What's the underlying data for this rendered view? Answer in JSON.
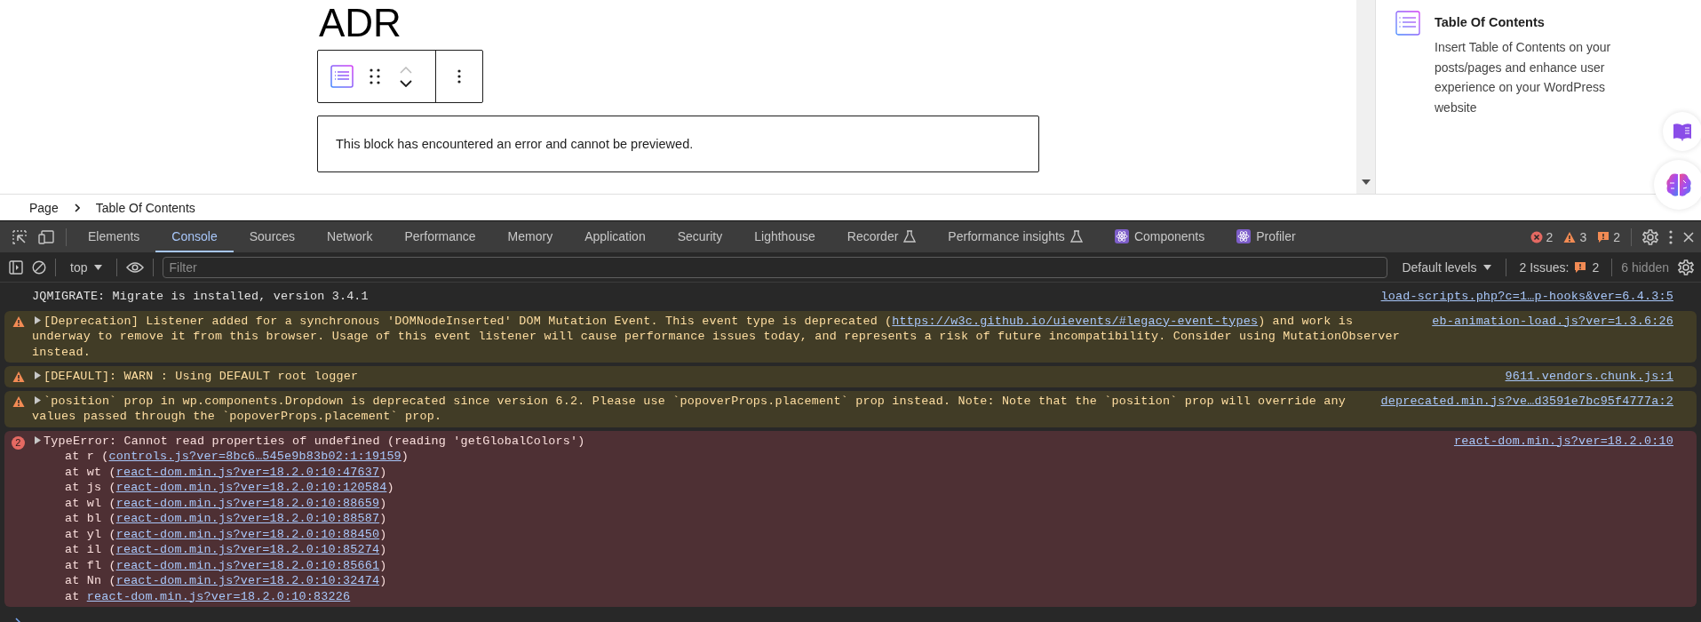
{
  "editor": {
    "heading": "ADR",
    "error_notice": "This block has encountered an error and cannot be previewed."
  },
  "sidebar": {
    "block_title": "Table Of Contents",
    "block_description": "Insert Table of Contents on your posts/pages and enhance user experience on your WordPress website"
  },
  "breadcrumb": [
    "Page",
    "Table Of Contents"
  ],
  "devtools": {
    "tabs": [
      {
        "label": "Elements",
        "selected": false,
        "kind": "plain"
      },
      {
        "label": "Console",
        "selected": true,
        "kind": "plain"
      },
      {
        "label": "Sources",
        "selected": false,
        "kind": "plain"
      },
      {
        "label": "Network",
        "selected": false,
        "kind": "plain"
      },
      {
        "label": "Performance",
        "selected": false,
        "kind": "plain"
      },
      {
        "label": "Memory",
        "selected": false,
        "kind": "plain"
      },
      {
        "label": "Application",
        "selected": false,
        "kind": "plain"
      },
      {
        "label": "Security",
        "selected": false,
        "kind": "plain"
      },
      {
        "label": "Lighthouse",
        "selected": false,
        "kind": "plain"
      },
      {
        "label": "Recorder",
        "selected": false,
        "kind": "experimental"
      },
      {
        "label": "Performance insights",
        "selected": false,
        "kind": "experimental"
      },
      {
        "label": "Components",
        "selected": false,
        "kind": "extension"
      },
      {
        "label": "Profiler",
        "selected": false,
        "kind": "extension"
      }
    ],
    "counts": {
      "errors": "2",
      "warnings": "3",
      "issues": "2"
    },
    "console_toolbar": {
      "context": "top",
      "filter_placeholder": "Filter",
      "levels": "Default levels",
      "issues_label": "2 Issues:",
      "issues_count": "2",
      "hidden": "6 hidden"
    },
    "messages": [
      {
        "kind": "info",
        "parts": [
          {
            "text": "JQMIGRATE: Migrate is installed, version 3.4.1"
          }
        ],
        "source": "load-scripts.php?c=1…p-hooks&ver=6.4.3:5"
      },
      {
        "kind": "warning",
        "parts": [
          {
            "text": "[Deprecation] Listener added for a synchronous 'DOMNodeInserted' DOM Mutation Event. This event type is deprecated ("
          },
          {
            "link": "https://w3c.github.io/uievents/#legacy-event-types"
          },
          {
            "text": ") and work is underway to remove it from this browser. Usage of this event listener will cause performance issues today, and represents a risk of future incompatibility. Consider using MutationObserver instead."
          }
        ],
        "source": "eb-animation-load.js?ver=1.3.6:26"
      },
      {
        "kind": "warning",
        "parts": [
          {
            "text": "[DEFAULT]: WARN : Using DEFAULT root logger"
          }
        ],
        "source": "9611.vendors.chunk.js:1"
      },
      {
        "kind": "warning",
        "parts": [
          {
            "text": "`position` prop in wp.components.Dropdown is deprecated since version 6.2. Please use `popoverProps.placement` prop instead. Note: Note that the `position` prop will override any values passed through the `popoverProps.placement` prop."
          }
        ],
        "source": "deprecated.min.js?ve…d3591e7bc95f4777a:2"
      },
      {
        "kind": "error",
        "count": "2",
        "parts": [
          {
            "text": "TypeError: Cannot read properties of undefined (reading 'getGlobalColors')"
          }
        ],
        "source": "react-dom.min.js?ver=18.2.0:10",
        "stack": [
          {
            "prefix": "at r (",
            "link": "controls.js?ver=8bc6…545e9b83b02:1:19159",
            "suffix": ")"
          },
          {
            "prefix": "at wt (",
            "link": "react-dom.min.js?ver=18.2.0:10:47637",
            "suffix": ")"
          },
          {
            "prefix": "at js (",
            "link": "react-dom.min.js?ver=18.2.0:10:120584",
            "suffix": ")"
          },
          {
            "prefix": "at wl (",
            "link": "react-dom.min.js?ver=18.2.0:10:88659",
            "suffix": ")"
          },
          {
            "prefix": "at bl (",
            "link": "react-dom.min.js?ver=18.2.0:10:88587",
            "suffix": ")"
          },
          {
            "prefix": "at yl (",
            "link": "react-dom.min.js?ver=18.2.0:10:88450",
            "suffix": ")"
          },
          {
            "prefix": "at il (",
            "link": "react-dom.min.js?ver=18.2.0:10:85274",
            "suffix": ")"
          },
          {
            "prefix": "at fl (",
            "link": "react-dom.min.js?ver=18.2.0:10:85661",
            "suffix": ")"
          },
          {
            "prefix": "at Nn (",
            "link": "react-dom.min.js?ver=18.2.0:10:32474",
            "suffix": ")"
          },
          {
            "prefix": "at ",
            "link": "react-dom.min.js?ver=18.2.0:10:83226"
          }
        ]
      }
    ]
  }
}
